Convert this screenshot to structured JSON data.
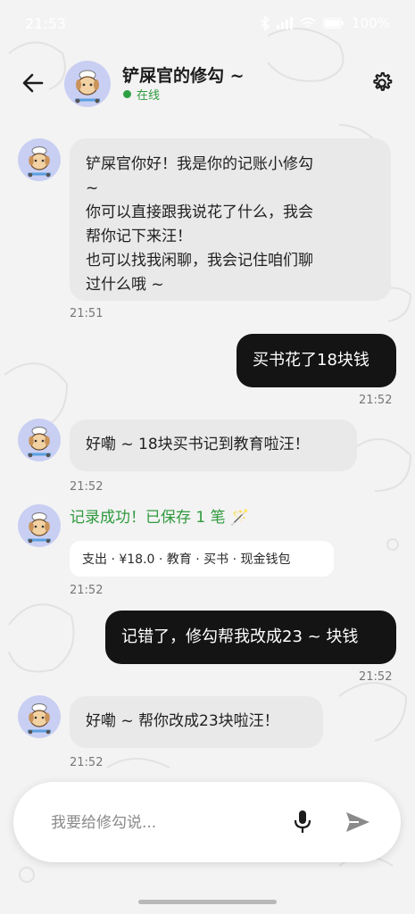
{
  "status_bar": {
    "time": "21:53",
    "battery": "100%"
  },
  "header": {
    "title": "铲屎官的修勾 ~",
    "status": "在线"
  },
  "messages": [
    {
      "sender": "bot",
      "lines": [
        "铲屎官你好！我是你的记账小修勾",
        "~",
        "你可以直接跟我说花了什么，我会",
        "帮你记下来汪！",
        "也可以找我闲聊，我会记住咱们聊",
        "过什么哦 ~"
      ],
      "time": "21:51"
    },
    {
      "sender": "user",
      "text": "买书花了18块钱",
      "time": "21:52"
    },
    {
      "sender": "bot",
      "text": "好嘞 ~ 18块买书记到教育啦汪！",
      "time": "21:52"
    },
    {
      "sender": "bot",
      "success": "记录成功！已保存 1 笔 🪄",
      "record": "支出 · ¥18.0 · 教育 · 买书 · 现金钱包",
      "time": "21:52"
    },
    {
      "sender": "user",
      "text": "记错了，修勾帮我改成23 ~ 块钱",
      "time": "21:52"
    },
    {
      "sender": "bot",
      "text": "好嘞 ~ 帮你改成23块啦汪！",
      "time": "21:52"
    }
  ],
  "input": {
    "placeholder": "我要给修勾说..."
  },
  "icons": {
    "back": "arrow-left-icon",
    "settings": "gear-icon",
    "mic": "microphone-icon",
    "send": "send-icon"
  },
  "colors": {
    "online": "#2ea043",
    "user_bubble": "#141414",
    "bot_bubble": "#e9e9e9",
    "success": "#2f9a3d",
    "avatar_bg": "#c9cff3"
  }
}
